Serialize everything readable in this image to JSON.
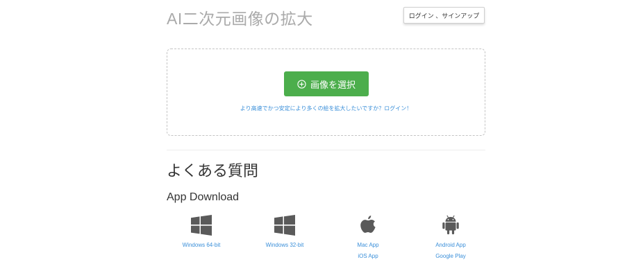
{
  "header": {
    "site_title": "AI二次元画像の拡大",
    "login_label": "ログイン 、サインアップ"
  },
  "upload": {
    "select_label": "画像を選択",
    "login_prompt": "より高速でかつ安定により多くの絵を拡大したいですか？ログイン！"
  },
  "faq": {
    "heading": "よくある質問"
  },
  "downloads": {
    "heading": "App Download",
    "items": [
      {
        "icon": "windows-icon",
        "links": [
          "Windows 64-bit"
        ]
      },
      {
        "icon": "windows-icon",
        "links": [
          "Windows 32-bit"
        ]
      },
      {
        "icon": "apple-icon",
        "links": [
          "Mac App",
          "iOS App"
        ]
      },
      {
        "icon": "android-icon",
        "links": [
          "Android App",
          "Google Play"
        ]
      }
    ]
  },
  "colors": {
    "accent_green": "#4cae4c",
    "link_blue": "#3a8fd9",
    "title_gray": "#aaaaaa",
    "icon_gray": "#5a5a5a"
  }
}
